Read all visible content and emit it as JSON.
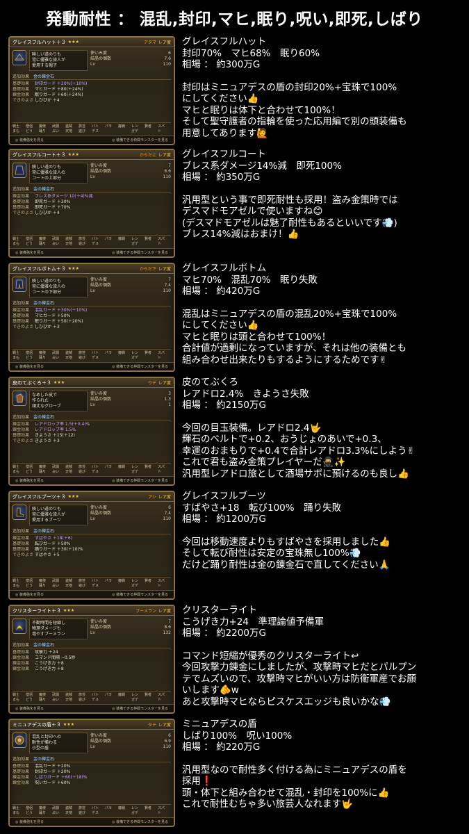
{
  "header": {
    "title": "発動耐性 ： 混乱,封印,マヒ,眠り,呪い,即死,しばり"
  },
  "panel_common": {
    "slot_label": "追加効果",
    "gem_label": "金の錬金石",
    "footer_left": "装備強化を見る",
    "footer_right": "装備できる仲間モンスターを見る",
    "jobs": [
      "戦士",
      "僧侶",
      "魔使",
      "武闘",
      "盗賊",
      "旅芸",
      "バト",
      "パラ",
      "魔戦",
      "レン",
      "賢者",
      "スパ"
    ],
    "jobs2": [
      "まも",
      "どう",
      "踊り",
      "占い",
      "天地",
      "遊び",
      "デス",
      "",
      "",
      "ガデ",
      "",
      "ト"
    ]
  },
  "sections": [
    {
      "panel": {
        "item_name": "グレイスフルハット＋３",
        "stars": "★★★",
        "tag": "アタマ",
        "rarity": "レア度",
        "desc": [
          "険しい道のりも",
          "常に優雅な旅人が",
          "愛用する帽子"
        ],
        "stats": [
          [
            "使いみ度",
            "6"
          ],
          [
            "結晶の個数",
            "7.6"
          ],
          [
            "Lv",
            "110"
          ]
        ],
        "effects": [
          [
            "基礎効果",
            "封印ガード ＋20%(＋10%)",
            "purple"
          ],
          [
            "基礎効果",
            "マヒガード ＋80(＋24%)",
            "white"
          ],
          [
            "錬金効果",
            "眠りガード ＋60(＋24%)",
            "white"
          ],
          [
            "できのよさ",
            "しひびか ＋4",
            "white"
          ]
        ]
      },
      "lines": [
        "グレイスフルハット",
        "封印70%　マヒ68%　眠り60%",
        "相場 ： 約300万G",
        "",
        "封印はミニュアデスの盾の封印20%+宝珠で100%",
        "にしてください👍",
        "マヒと眠りは体下と合わせて100%！",
        "そして聖守護者の指輪を使った応用編で別の頭装備も",
        "用意してあります🙋"
      ]
    },
    {
      "panel": {
        "item_name": "グレイスフルコート＋３",
        "stars": "★★★",
        "tag": "からだ上",
        "rarity": "レア度",
        "desc": [
          "険しい道のりも",
          "常に優雅な旅人の",
          "コートの上部分"
        ],
        "stats": [
          [
            "使いみ度",
            "7"
          ],
          [
            "結晶の個数",
            "6.6"
          ],
          [
            "Lv",
            "110"
          ]
        ],
        "effects": [
          [
            "錬金効果",
            "ブレス系ダメージ 10(＋4)%減",
            "purple"
          ],
          [
            "基礎効果",
            "即死ガード ＋30%",
            "white"
          ],
          [
            "基礎効果",
            "即死ガード ＋70%",
            "white"
          ],
          [
            "できのよさ",
            "しひびか ＋4",
            "white"
          ]
        ]
      },
      "lines": [
        "グレイスフルコート",
        "ブレス系ダメージ14%減　即死100%",
        "相場 ： 約350万G",
        "",
        "汎用型という事で即死耐性も採用！盗み金策時では",
        "デスマドモアゼルで使いますね😊",
        "(デスマドモアゼルは魅了耐性もあるといいです💨)",
        "ブレス14%減はおまけ！👍"
      ]
    },
    {
      "panel": {
        "item_name": "グレイスフルボトム＋３",
        "stars": "★★★",
        "tag": "からだ下",
        "rarity": "レア度",
        "desc": [
          "険しい道のりも",
          "常に優雅な旅人の",
          "コートの下部分"
        ],
        "stats": [
          [
            "使いみ度",
            "7"
          ],
          [
            "結晶の個数",
            "7.4"
          ],
          [
            "Lv",
            "110"
          ]
        ],
        "effects": [
          [
            "錬金効果",
            "混乱ガード ＋30%(＋10%)",
            "purple"
          ],
          [
            "基礎効果",
            "マヒガード ＋50%",
            "white"
          ],
          [
            "基礎効果",
            "眠りガード ＋50(＋20%)",
            "white"
          ],
          [
            "できのよさ",
            "しひびか ＋3",
            "white"
          ]
        ]
      },
      "lines": [
        "グレイスフルボトム",
        "マヒ70%　混乱70%　眠り失敗",
        "相場 ： 約420万G",
        "",
        "混乱はミニュアデスの盾の混乱20%+宝珠で100%",
        "にしてください👍",
        "マヒと眠りは頭と合わせて100%！",
        "合計値が過剰になっていますが、それは他の装備とも",
        "組み合わせ出来たりもするようにするためです✌"
      ]
    },
    {
      "panel": {
        "item_name": "皮のてぶくろ＋３",
        "stars": "★★★",
        "tag": "ウデ",
        "rarity": "レア度",
        "desc": [
          "なめした皮で",
          "作られた",
          "頑丈なグローブ"
        ],
        "stats": [
          [
            "使いみ度",
            "3"
          ],
          [
            "結晶の個数",
            "1.3"
          ],
          [
            "Lv",
            "1"
          ]
        ],
        "effects": [
          [
            "錬金効果",
            "レアドロップ率 1.5(＋0.4)%",
            "purple"
          ],
          [
            "錬金効果",
            "レアドロップ率 1.5%",
            "purple"
          ],
          [
            "基礎効果",
            "きようさ ＋15(＋12)",
            "white"
          ],
          [
            "できのよさ",
            "きようさ ＋3",
            "white"
          ]
        ]
      },
      "lines": [
        "皮のてぶくろ",
        "レアドロ2.4%　きようさ失敗",
        "相場 ： 約2150万G",
        "",
        "今回の目玉装備。レアドロ2.4🤟",
        "輝石のベルトで+0.2、おうじょのあいで+0.3、",
        "幸運のおまもりで+0.4で合計レアドロ3.3%にしよう✌",
        "これで君も盗み金策プレイヤーだ🥷✨",
        "汎用型レアドロ旅として酒場サポに預けるのも良し👍"
      ]
    },
    {
      "panel": {
        "item_name": "グレイスフルブーツ＋３",
        "stars": "★★★",
        "tag": "アシ",
        "rarity": "レア度",
        "desc": [
          "険しい道のりも",
          "常に優雅な旅人が",
          "愛用するブーツ"
        ],
        "stats": [
          [
            "使いみ度",
            "6"
          ],
          [
            "結晶の個数",
            "7.4"
          ],
          [
            "Lv",
            "110"
          ]
        ],
        "effects": [
          [
            "錬金効果",
            "すばやさ ＋18(＋6)",
            "purple"
          ],
          [
            "基礎効果",
            "転びガード ＋50%",
            "white"
          ],
          [
            "基礎効果",
            "踊りガード ＋30(＋10)%",
            "white"
          ],
          [
            "できのよさ",
            "すばやさ ＋5",
            "white"
          ]
        ]
      },
      "lines": [
        "グレイスフルブーツ",
        "すばやさ+18　転び100%　踊り失敗",
        "相場 ： 約1200万G",
        "",
        "今回は移動速度よりもすばやさを採用しました👍",
        "そして転び耐性は安定の宝珠無し100%💨",
        "だけど踊り耐性は金の錬金石で直してください🙏"
      ]
    },
    {
      "panel": {
        "item_name": "クリスターライト＋３",
        "stars": "★★★",
        "tag": "ブーメラン",
        "rarity": "レア度",
        "desc": [
          "不動時間を短縮し",
          "物理ダメージも",
          "増やすブーメラン"
        ],
        "stats": [
          [
            "使いみ度",
            "7"
          ],
          [
            "結晶の個数",
            "8.6"
          ],
          [
            "Lv",
            "132"
          ]
        ],
        "effects": [
          [
            "基礎効果",
            "攻撃力 ＋24",
            "white"
          ],
          [
            "錬金効果",
            "コマンド間隔 −0.5秒",
            "white"
          ],
          [
            "錬金効果",
            "こうげき力 ＋8",
            "white"
          ],
          [
            "錬金効果",
            "こうげき力 ＋8",
            "white"
          ]
        ]
      },
      "lines": [
        "クリスターライト",
        "こうげき力+24　準理論値予備軍",
        "相場 ： 約2200万G",
        "",
        "コマンド短縮が優秀のクリスターライト↩",
        "今回攻撃力錬金にしましたが、攻撃時マヒだとパルプン",
        "テでムズいので、攻撃時マヒがいい方は防衛軍産でお願",
        "いします🫵w",
        "あと攻撃時マヒならピスケスエッジも良いかな💨"
      ]
    },
    {
      "panel": {
        "item_name": "ミニュアデスの盾＋３",
        "stars": "★★★",
        "tag": "タテ",
        "rarity": "レア度",
        "desc": [
          "混乱と封印への",
          "耐性が備わる",
          "小型の盾"
        ],
        "stats": [
          [
            "使いみ度",
            "6"
          ],
          [
            "結晶の個数",
            "6.9"
          ],
          [
            "Lv",
            "110"
          ]
        ],
        "effects": [
          [
            "基礎効果",
            "混乱ガード ＋20%",
            "white"
          ],
          [
            "基礎効果",
            "封印ガード ＋20%",
            "white"
          ],
          [
            "錬金効果",
            "しばりガード ＋60(＋18)%",
            "purple"
          ],
          [
            "錬金効果",
            "呪いガード ＋60%",
            "white"
          ]
        ]
      },
      "lines": [
        "ミニュアデスの盾",
        "しばり100%　呪い100%",
        "相場 ： 約220万G",
        "",
        "汎用型なので耐性多く付ける為にミニュアデスの盾を",
        "採用❗",
        "頭・体下と組み合わせて混乱・封印を100%に👍",
        "これで耐性むちゃ多い旅芸人なれます🤟"
      ]
    }
  ]
}
